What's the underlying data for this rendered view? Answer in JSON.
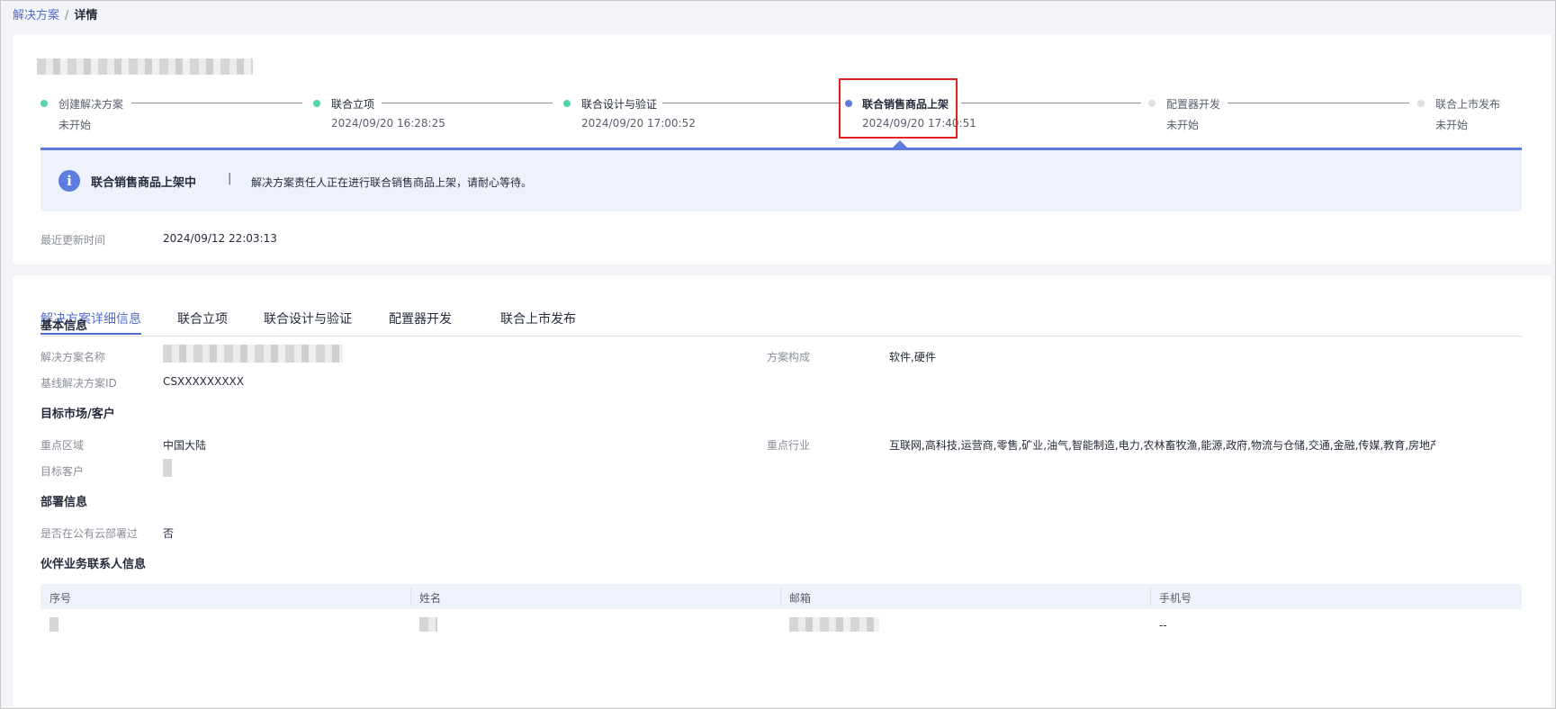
{
  "breadcrumb": {
    "parent": "解决方案",
    "separator": "/",
    "current": "详情"
  },
  "steps": [
    {
      "label": "创建解决方案",
      "time": "未开始",
      "status": "done"
    },
    {
      "label": "联合立项",
      "time": "2024/09/20 16:28:25",
      "status": "done"
    },
    {
      "label": "联合设计与验证",
      "time": "2024/09/20 17:00:52",
      "status": "done"
    },
    {
      "label": "联合销售商品上架",
      "time": "2024/09/20 17:40:51",
      "status": "active"
    },
    {
      "label": "配置器开发",
      "time": "未开始",
      "status": "pending"
    },
    {
      "label": "联合上市发布",
      "time": "未开始",
      "status": "pending"
    }
  ],
  "info": {
    "icon": "info-icon",
    "title": "联合销售商品上架中",
    "divider": "|",
    "message": "解决方案责任人正在进行联合销售商品上架，请耐心等待。"
  },
  "update": {
    "label": "最近更新时间",
    "value": "2024/09/12 22:03:13"
  },
  "tabs": [
    "解决方案详细信息",
    "联合立项",
    "联合设计与验证",
    "配置器开发",
    "联合上市发布"
  ],
  "basic": {
    "title": "基本信息",
    "name_label": "解决方案名称",
    "composition_label": "方案构成",
    "composition_value": "软件,硬件",
    "baseline_label": "基线解决方案ID",
    "baseline_value": "CSXXXXXXXXX"
  },
  "market": {
    "title": "目标市场/客户",
    "region_label": "重点区域",
    "region_value": "中国大陆",
    "industry_label": "重点行业",
    "industry_value": "互联网,高科技,运营商,零售,矿业,油气,智能制造,电力,农林畜牧渔,能源,政府,物流与仓储,交通,金融,传媒,教育,房地产",
    "customer_label": "目标客户"
  },
  "deploy": {
    "title": "部署信息",
    "cloud_label": "是否在公有云部署过",
    "cloud_value": "否"
  },
  "contacts": {
    "title": "伙伴业务联系人信息",
    "columns": [
      "序号",
      "姓名",
      "邮箱",
      "手机号"
    ],
    "row_phone": "--"
  },
  "colors": {
    "accent": "#526ecc",
    "done": "#50d4ab",
    "active": "#5e7ce0",
    "pending": "#dfe1e6",
    "highlight": "#e02020"
  }
}
